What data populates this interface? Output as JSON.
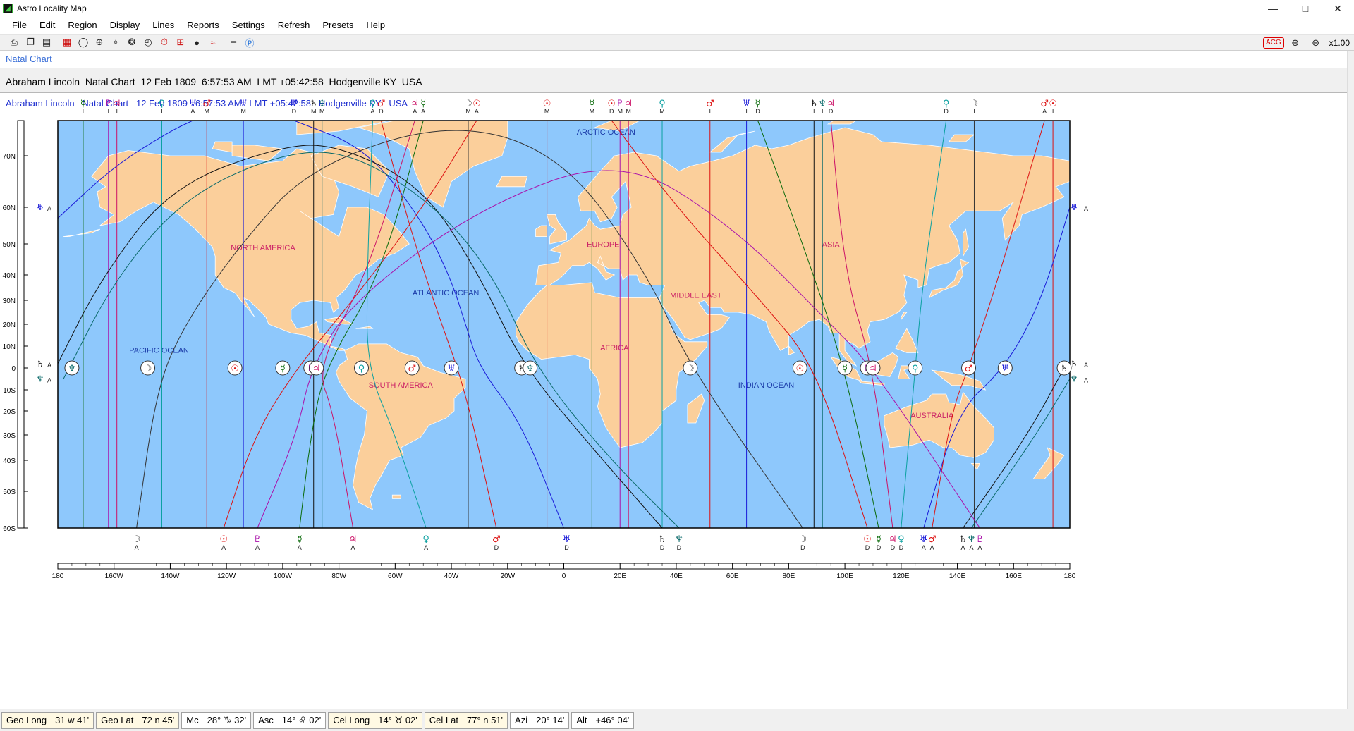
{
  "window": {
    "title": "Astro Locality Map",
    "controls": [
      "—",
      "□",
      "✕"
    ]
  },
  "menu": [
    "File",
    "Edit",
    "Region",
    "Display",
    "Lines",
    "Reports",
    "Settings",
    "Refresh",
    "Presets",
    "Help"
  ],
  "toolbar": {
    "buttons": [
      {
        "icon": "print-icon",
        "glyph": "⎙"
      },
      {
        "icon": "copy-icon",
        "glyph": "❐"
      },
      {
        "icon": "document-icon",
        "glyph": "▤"
      },
      {
        "icon": "calendar-icon",
        "glyph": "▦"
      },
      {
        "icon": "globe-icon",
        "glyph": "◯"
      },
      {
        "icon": "world-icon",
        "glyph": "⊕"
      },
      {
        "icon": "crosshair-icon",
        "glyph": "⌖"
      },
      {
        "icon": "chart-wheel-icon",
        "glyph": "❂"
      },
      {
        "icon": "clock-icon",
        "glyph": "◴"
      },
      {
        "icon": "time-icon",
        "glyph": "⏱"
      },
      {
        "icon": "geo-icon",
        "glyph": "⊞"
      },
      {
        "icon": "sun-icon",
        "glyph": "●"
      },
      {
        "icon": "waves-icon",
        "glyph": "≈"
      },
      {
        "icon": "ruler-icon",
        "glyph": "━"
      },
      {
        "icon": "info-icon",
        "glyph": "Ⓟ"
      }
    ],
    "acg": "ACG",
    "zoom_in": "⊕",
    "zoom_out": "⊖",
    "zoom_level": "x1.00"
  },
  "tab": {
    "label": "Natal Chart"
  },
  "chart_header": "Abraham Lincoln  Natal Chart  12 Feb 1809  6:57:53 AM  LMT +05:42:58  Hodgenville KY  USA",
  "map": {
    "subtitle": "Abraham Lincoln   Natal Chart   12 Feb 1809   6:57:53 AM   LMT +05:42:58   Hodgenville KY   USA",
    "lat_labels": [
      "70N",
      "60N",
      "50N",
      "40N",
      "30N",
      "20N",
      "10N",
      "0",
      "10S",
      "20S",
      "30S",
      "40S",
      "50S",
      "60S"
    ],
    "lat_values": [
      70,
      60,
      50,
      40,
      30,
      20,
      10,
      0,
      -10,
      -20,
      -30,
      -40,
      -50,
      -60
    ],
    "lon_labels": [
      "180",
      "160W",
      "140W",
      "120W",
      "100W",
      "80W",
      "60W",
      "40W",
      "20W",
      "0",
      "20E",
      "40E",
      "60E",
      "80E",
      "100E",
      "120E",
      "140E",
      "160E",
      "180"
    ],
    "regions": [
      {
        "name": "ARCTIC OCEAN",
        "lon": 15,
        "lat": 76,
        "color": "#1a3aa8"
      },
      {
        "name": "NORTH AMERICA",
        "lon": -107,
        "lat": 48,
        "color": "#cc2266"
      },
      {
        "name": "EUROPE",
        "lon": 14,
        "lat": 49,
        "color": "#cc2266"
      },
      {
        "name": "ASIA",
        "lon": 95,
        "lat": 49,
        "color": "#cc2266"
      },
      {
        "name": "ATLANTIC OCEAN",
        "lon": -42,
        "lat": 32,
        "color": "#1a3aa8"
      },
      {
        "name": "MIDDLE EAST",
        "lon": 47,
        "lat": 31,
        "color": "#cc2266"
      },
      {
        "name": "PACIFIC OCEAN",
        "lon": -144,
        "lat": 7,
        "color": "#1a3aa8"
      },
      {
        "name": "AFRICA",
        "lon": 18,
        "lat": 8,
        "color": "#cc2266"
      },
      {
        "name": "SOUTH AMERICA",
        "lon": -58,
        "lat": -9,
        "color": "#cc2266"
      },
      {
        "name": "INDIAN OCEAN",
        "lon": 72,
        "lat": -9,
        "color": "#1a3aa8"
      },
      {
        "name": "AUSTRALIA",
        "lon": 131,
        "lat": -23,
        "color": "#cc2266"
      }
    ],
    "top_symbols": [
      {
        "g": "☿",
        "l": "I",
        "c": "#0a6a0a",
        "lon": -171
      },
      {
        "g": "♇",
        "l": "I",
        "c": "#aa10aa",
        "lon": -162
      },
      {
        "g": "♃",
        "l": "I",
        "c": "#cc1166",
        "lon": -159
      },
      {
        "g": "♀",
        "l": "I",
        "c": "#0aa0a0",
        "lon": -143
      },
      {
        "g": "♅",
        "l": "A",
        "c": "#1a1ad8",
        "lon": -132
      },
      {
        "g": "♂",
        "l": "M",
        "c": "#dd1111",
        "lon": -127
      },
      {
        "g": "♅",
        "l": "M",
        "c": "#1a1ad8",
        "lon": -114
      },
      {
        "g": "♅",
        "l": "D",
        "c": "#1a1ad8",
        "lon": -96
      },
      {
        "g": "♄",
        "l": "M",
        "c": "#111111",
        "lon": -89
      },
      {
        "g": "♆",
        "l": "M",
        "c": "#0a6a6a",
        "lon": -86
      },
      {
        "g": "♀",
        "l": "A",
        "c": "#0aa0a0",
        "lon": -68
      },
      {
        "g": "♂",
        "l": "D",
        "c": "#dd1111",
        "lon": -65
      },
      {
        "g": "♃",
        "l": "A",
        "c": "#cc1166",
        "lon": -53
      },
      {
        "g": "☿",
        "l": "A",
        "c": "#0a6a0a",
        "lon": -50
      },
      {
        "g": "☽",
        "l": "M",
        "c": "#333333",
        "lon": -34
      },
      {
        "g": "☉",
        "l": "A",
        "c": "#dd1111",
        "lon": -31
      },
      {
        "g": "☉",
        "l": "M",
        "c": "#dd1111",
        "lon": -6
      },
      {
        "g": "☿",
        "l": "M",
        "c": "#0a6a0a",
        "lon": 10
      },
      {
        "g": "☉",
        "l": "D",
        "c": "#dd1111",
        "lon": 17
      },
      {
        "g": "♇",
        "l": "M",
        "c": "#aa10aa",
        "lon": 20
      },
      {
        "g": "♃",
        "l": "M",
        "c": "#cc1166",
        "lon": 23
      },
      {
        "g": "♀",
        "l": "M",
        "c": "#0aa0a0",
        "lon": 35
      },
      {
        "g": "♂",
        "l": "I",
        "c": "#dd1111",
        "lon": 52
      },
      {
        "g": "♅",
        "l": "I",
        "c": "#1a1ad8",
        "lon": 65
      },
      {
        "g": "☿",
        "l": "D",
        "c": "#0a6a0a",
        "lon": 69
      },
      {
        "g": "♄",
        "l": "I",
        "c": "#111111",
        "lon": 89
      },
      {
        "g": "♆",
        "l": "I",
        "c": "#0a6a6a",
        "lon": 92
      },
      {
        "g": "♃",
        "l": "D",
        "c": "#cc1166",
        "lon": 95
      },
      {
        "g": "♀",
        "l": "D",
        "c": "#0aa0a0",
        "lon": 136
      },
      {
        "g": "☽",
        "l": "I",
        "c": "#333333",
        "lon": 146
      },
      {
        "g": "♂",
        "l": "A",
        "c": "#dd1111",
        "lon": 171
      },
      {
        "g": "☉",
        "l": "I",
        "c": "#dd1111",
        "lon": 174
      }
    ],
    "bottom_symbols": [
      {
        "g": "☽",
        "l": "A",
        "c": "#333333",
        "lon": -152
      },
      {
        "g": "☉",
        "l": "A",
        "c": "#dd1111",
        "lon": -121
      },
      {
        "g": "♇",
        "l": "A",
        "c": "#aa10aa",
        "lon": -109
      },
      {
        "g": "☿",
        "l": "A",
        "c": "#0a6a0a",
        "lon": -94
      },
      {
        "g": "♃",
        "l": "A",
        "c": "#cc1166",
        "lon": -75
      },
      {
        "g": "♀",
        "l": "A",
        "c": "#0aa0a0",
        "lon": -49
      },
      {
        "g": "♂",
        "l": "D",
        "c": "#dd1111",
        "lon": -24
      },
      {
        "g": "♅",
        "l": "D",
        "c": "#1a1ad8",
        "lon": 1
      },
      {
        "g": "♄",
        "l": "D",
        "c": "#111111",
        "lon": 35
      },
      {
        "g": "♆",
        "l": "D",
        "c": "#0a6a6a",
        "lon": 41
      },
      {
        "g": "☽",
        "l": "D",
        "c": "#333333",
        "lon": 85
      },
      {
        "g": "☉",
        "l": "D",
        "c": "#dd1111",
        "lon": 108
      },
      {
        "g": "☿",
        "l": "D",
        "c": "#0a6a0a",
        "lon": 112
      },
      {
        "g": "♃",
        "l": "D",
        "c": "#cc1166",
        "lon": 117
      },
      {
        "g": "♀",
        "l": "D",
        "c": "#0aa0a0",
        "lon": 120
      },
      {
        "g": "♅",
        "l": "A",
        "c": "#1a1ad8",
        "lon": 128
      },
      {
        "g": "♂",
        "l": "A",
        "c": "#dd1111",
        "lon": 131
      },
      {
        "g": "♄",
        "l": "A",
        "c": "#111111",
        "lon": 142
      },
      {
        "g": "♆",
        "l": "A",
        "c": "#0a6a6a",
        "lon": 145
      },
      {
        "g": "♇",
        "l": "A",
        "c": "#aa10aa",
        "lon": 148
      }
    ],
    "equator_symbols": [
      {
        "g": "♆",
        "c": "#0a6a6a",
        "lon": -175
      },
      {
        "g": "☽",
        "c": "#333333",
        "lon": -148
      },
      {
        "g": "☉",
        "c": "#dd1111",
        "lon": -117
      },
      {
        "g": "☿",
        "c": "#0a6a0a",
        "lon": -100
      },
      {
        "g": "♇",
        "c": "#aa10aa",
        "lon": -90
      },
      {
        "g": "♃",
        "c": "#cc1166",
        "lon": -88
      },
      {
        "g": "♀",
        "c": "#0aa0a0",
        "lon": -72
      },
      {
        "g": "♂",
        "c": "#dd1111",
        "lon": -54
      },
      {
        "g": "♅",
        "c": "#1a1ad8",
        "lon": -40
      },
      {
        "g": "♄",
        "c": "#111111",
        "lon": -15
      },
      {
        "g": "♆",
        "c": "#0a6a6a",
        "lon": -12
      },
      {
        "g": "☽",
        "c": "#333333",
        "lon": 45
      },
      {
        "g": "☉",
        "c": "#dd1111",
        "lon": 84
      },
      {
        "g": "☿",
        "c": "#0a6a0a",
        "lon": 100
      },
      {
        "g": "♇",
        "c": "#aa10aa",
        "lon": 108
      },
      {
        "g": "♃",
        "c": "#cc1166",
        "lon": 110
      },
      {
        "g": "♀",
        "c": "#0aa0a0",
        "lon": 125
      },
      {
        "g": "♂",
        "c": "#dd1111",
        "lon": 144
      },
      {
        "g": "♅",
        "c": "#1a1ad8",
        "lon": 157
      },
      {
        "g": "♄",
        "c": "#111111",
        "lon": 178
      }
    ],
    "side_symbols": [
      {
        "g": "♅",
        "l": "A",
        "c": "#1a1ad8",
        "lat": 60,
        "side": "both"
      },
      {
        "g": "♄",
        "l": "A",
        "c": "#111111",
        "lat": 2,
        "side": "both"
      },
      {
        "g": "♆",
        "l": "A",
        "c": "#0a6a6a",
        "lat": -5,
        "side": "both"
      }
    ],
    "vertical_lines": [
      {
        "lon": -171,
        "c": "#0a6a0a"
      },
      {
        "lon": -162,
        "c": "#aa10aa"
      },
      {
        "lon": -159,
        "c": "#cc1166"
      },
      {
        "lon": -143,
        "c": "#0aa0a0"
      },
      {
        "lon": -127,
        "c": "#dd1111"
      },
      {
        "lon": -114,
        "c": "#1a1ad8"
      },
      {
        "lon": -89,
        "c": "#111111"
      },
      {
        "lon": -86,
        "c": "#0a6a6a"
      },
      {
        "lon": -34,
        "c": "#333333"
      },
      {
        "lon": -6,
        "c": "#dd1111"
      },
      {
        "lon": 10,
        "c": "#0a6a0a"
      },
      {
        "lon": 20,
        "c": "#aa10aa"
      },
      {
        "lon": 23,
        "c": "#cc1166"
      },
      {
        "lon": 35,
        "c": "#0aa0a0"
      },
      {
        "lon": 52,
        "c": "#dd1111"
      },
      {
        "lon": 65,
        "c": "#1a1ad8"
      },
      {
        "lon": 89,
        "c": "#111111"
      },
      {
        "lon": 92,
        "c": "#0a6a6a"
      },
      {
        "lon": 146,
        "c": "#333333"
      },
      {
        "lon": 174,
        "c": "#dd1111"
      }
    ],
    "colors": {
      "ocean": "#8ec8fc",
      "land": "#fbcf9b",
      "border": "#ffffff"
    }
  },
  "status": [
    {
      "label": "Geo Long",
      "value": "31 w 41'",
      "style": "cream"
    },
    {
      "label": "Geo Lat",
      "value": "72 n 45'",
      "style": "cream"
    },
    {
      "label": "Mc",
      "value": "28° ♑ 32'",
      "style": "white"
    },
    {
      "label": "Asc",
      "value": "14° ♌ 02'",
      "style": "white"
    },
    {
      "label": "Cel Long",
      "value": "14° ♉ 02'",
      "style": "cream"
    },
    {
      "label": "Cel Lat",
      "value": "77° n 51'",
      "style": "cream"
    },
    {
      "label": "Azi",
      "value": "20° 14'",
      "style": "white"
    },
    {
      "label": "Alt",
      "value": "+46° 04'",
      "style": "white"
    }
  ]
}
